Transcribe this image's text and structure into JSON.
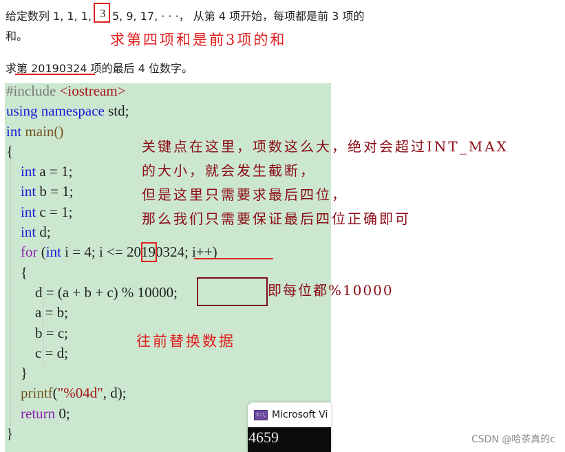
{
  "problem": {
    "line1_prefix": "给定数列 1, 1, 1,",
    "line1_boxed": "3",
    "line1_suffix": "5, 9, 17, · · ·， 从第 4 项开始，每项都是前 3 项的",
    "line2": "和。",
    "line3_prefix": "求",
    "line3_underlined": "第 20190324",
    "line3_suffix": " 项的最后 4 位数字。"
  },
  "annotations": {
    "fourth_term_note": "求第四项和是前3项的和",
    "key_point_lines": [
      "关键点在这里，项数这么大，绝对会超过INT_MAX",
      "的大小，就会发生截断，",
      "但是这里只需要求最后四位，",
      "那么我们只需要保证最后四位正确即可"
    ],
    "mod_note": "即每位都%10000",
    "shift_note": "往前替换数据"
  },
  "code": {
    "include_kw": "#include",
    "include_hdr": "<iostream>",
    "using_kw": "using namespace",
    "using_ns": " std;",
    "int_kw": "int",
    "main_sig": " main()",
    "open_brace": "{",
    "decl_a": " a = 1;",
    "decl_b": " b = 1;",
    "decl_c": " c = 1;",
    "decl_d": " d;",
    "for_kw": "for",
    "for_open": " (",
    "for_init_rest": " i = ",
    "for_init_val": "4",
    "for_cond_pre": "; i <",
    "for_cond_ul": "= 20190324",
    "for_tail": "; i++)",
    "inner_open": "{",
    "calc_pre": "d = (a + b + c) ",
    "calc_mod": "% 10000;",
    "shift_a": "a = b;",
    "shift_b": "b = c;",
    "shift_c": "c = d;",
    "inner_close": "}",
    "printf_fn": "printf",
    "printf_open": "(",
    "printf_fmt": "\"%04d\"",
    "printf_args": ", d);",
    "return_kw": "return",
    "return_val": " 0;",
    "close_brace": "}"
  },
  "console": {
    "title": "Microsoft Vi",
    "icon_label": "C:\\",
    "output": "4659"
  },
  "watermark": "CSDN @哈茶真的c"
}
